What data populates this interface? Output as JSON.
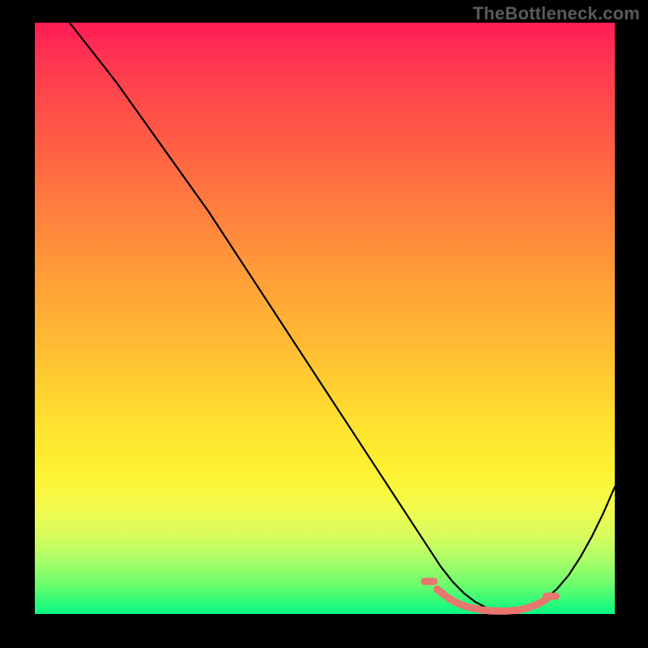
{
  "watermark": "TheBottleneck.com",
  "chart_data": {
    "type": "line",
    "title": "",
    "xlabel": "",
    "ylabel": "",
    "xlim": [
      0,
      100
    ],
    "ylim": [
      0,
      100
    ],
    "series": [
      {
        "name": "curve",
        "x": [
          6,
          10,
          14,
          18,
          22,
          26,
          30,
          34,
          38,
          42,
          46,
          50,
          54,
          58,
          62,
          66,
          68,
          70,
          72,
          74,
          76,
          78,
          80,
          82,
          84,
          86,
          88,
          90,
          92,
          94,
          96,
          98,
          100
        ],
        "y": [
          100,
          95,
          90,
          84.5,
          79,
          73.5,
          68,
          62,
          56,
          50,
          44,
          38,
          32,
          26,
          20,
          14,
          11,
          8,
          5.5,
          3.5,
          2,
          1,
          0.6,
          0.5,
          0.7,
          1.3,
          2.5,
          4.2,
          6.5,
          9.5,
          13,
          17,
          21.5
        ]
      }
    ],
    "trough_markers": {
      "x": [
        68,
        70,
        72,
        74,
        76,
        78,
        80,
        82,
        84,
        86,
        87.5,
        89
      ],
      "y": [
        5.5,
        3.7,
        2.3,
        1.4,
        0.9,
        0.6,
        0.5,
        0.55,
        0.8,
        1.4,
        2.1,
        3.0
      ]
    }
  }
}
